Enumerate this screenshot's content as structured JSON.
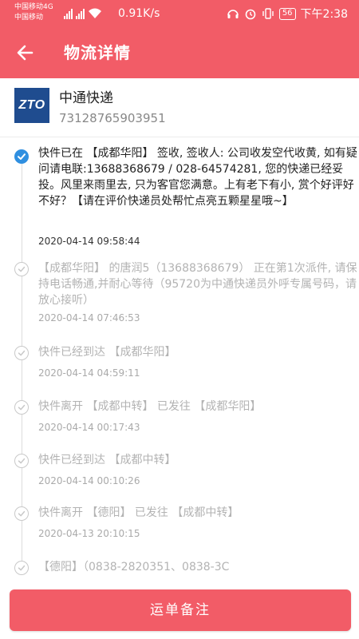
{
  "status_bar": {
    "carrier_1": "中国移动4G",
    "carrier_2": "中国移动",
    "network_badge": "4G",
    "speed": "0.91K/s",
    "battery": "56",
    "time": "下午2:38"
  },
  "header": {
    "title": "物流详情",
    "back_icon": "arrow-left-icon"
  },
  "courier": {
    "logo_text": "ZTO",
    "name": "中通快递",
    "tracking_number": "73128765903951"
  },
  "timeline": [
    {
      "text": "快件已在 【成都华阳】 签收, 签收人: 公司收发空代收黄, 如有疑问请电联:13688368679 / 028-64574281, 您的快递已经妥投。风里来雨里去, 只为客官您满意。上有老下有小, 赏个好评好不好？【请在评价快递员处帮忙点亮五颗星星哦~】",
      "time": "2020-04-14 09:58:44",
      "active": true
    },
    {
      "text": "【成都华阳】 的唐润5（13688368679） 正在第1次派件, 请保持电话畅通,并耐心等待（95720为中通快递员外呼专属号码，请放心接听）",
      "time": "2020-04-14 07:46:53",
      "active": false
    },
    {
      "text": "快件已经到达 【成都华阳】",
      "time": "2020-04-14 04:59:11",
      "active": false
    },
    {
      "text": "快件离开 【成都中转】 已发往 【成都华阳】",
      "time": "2020-04-14 00:17:43",
      "active": false
    },
    {
      "text": "快件已经到达 【成都中转】",
      "time": "2020-04-14 00:10:26",
      "active": false
    },
    {
      "text": "快件离开 【德阳】 已发往 【成都中转】",
      "time": "2020-04-13 20:10:15",
      "active": false
    },
    {
      "text": "【德阳】（0838-2820351、0838-3C",
      "time": "",
      "active": false
    }
  ],
  "footer": {
    "button_label": "运单备注"
  }
}
